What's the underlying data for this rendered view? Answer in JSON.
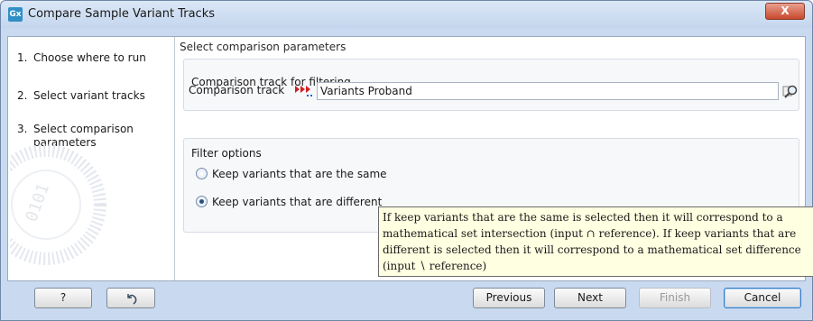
{
  "window": {
    "app_icon": "Gx",
    "title": "Compare Sample Variant Tracks",
    "close": "X"
  },
  "steps": [
    {
      "num": "1.",
      "label": "Choose where to run"
    },
    {
      "num": "2.",
      "label": "Select variant tracks"
    },
    {
      "num": "3.",
      "label": "Select comparison parameters"
    }
  ],
  "main": {
    "section_title": "Select comparison parameters",
    "comparison_group": {
      "legend": "Comparison track for filtering",
      "track_label": "Comparison track",
      "track_icon": "variant-track-icon",
      "track_value": "Variants Proband"
    },
    "filter_group": {
      "legend": "Filter options",
      "options": [
        {
          "label": "Keep variants that are the same",
          "checked": false
        },
        {
          "label": "Keep variants that are different",
          "checked": true
        }
      ]
    },
    "tooltip": "If keep variants that are the same is selected then it will correspond to a mathematical set intersection (input ∩ reference). If keep variants that are different is selected then it will correspond to a mathematical set difference (input ∖ reference)"
  },
  "buttons": {
    "help": "?",
    "reset_icon": "reset-icon",
    "previous": "Previous",
    "next": "Next",
    "finish": "Finish",
    "cancel": "Cancel"
  },
  "colors": {
    "frame": "#c9daf0",
    "close": "#c7482d",
    "tooltip_bg": "#ffffe1"
  }
}
